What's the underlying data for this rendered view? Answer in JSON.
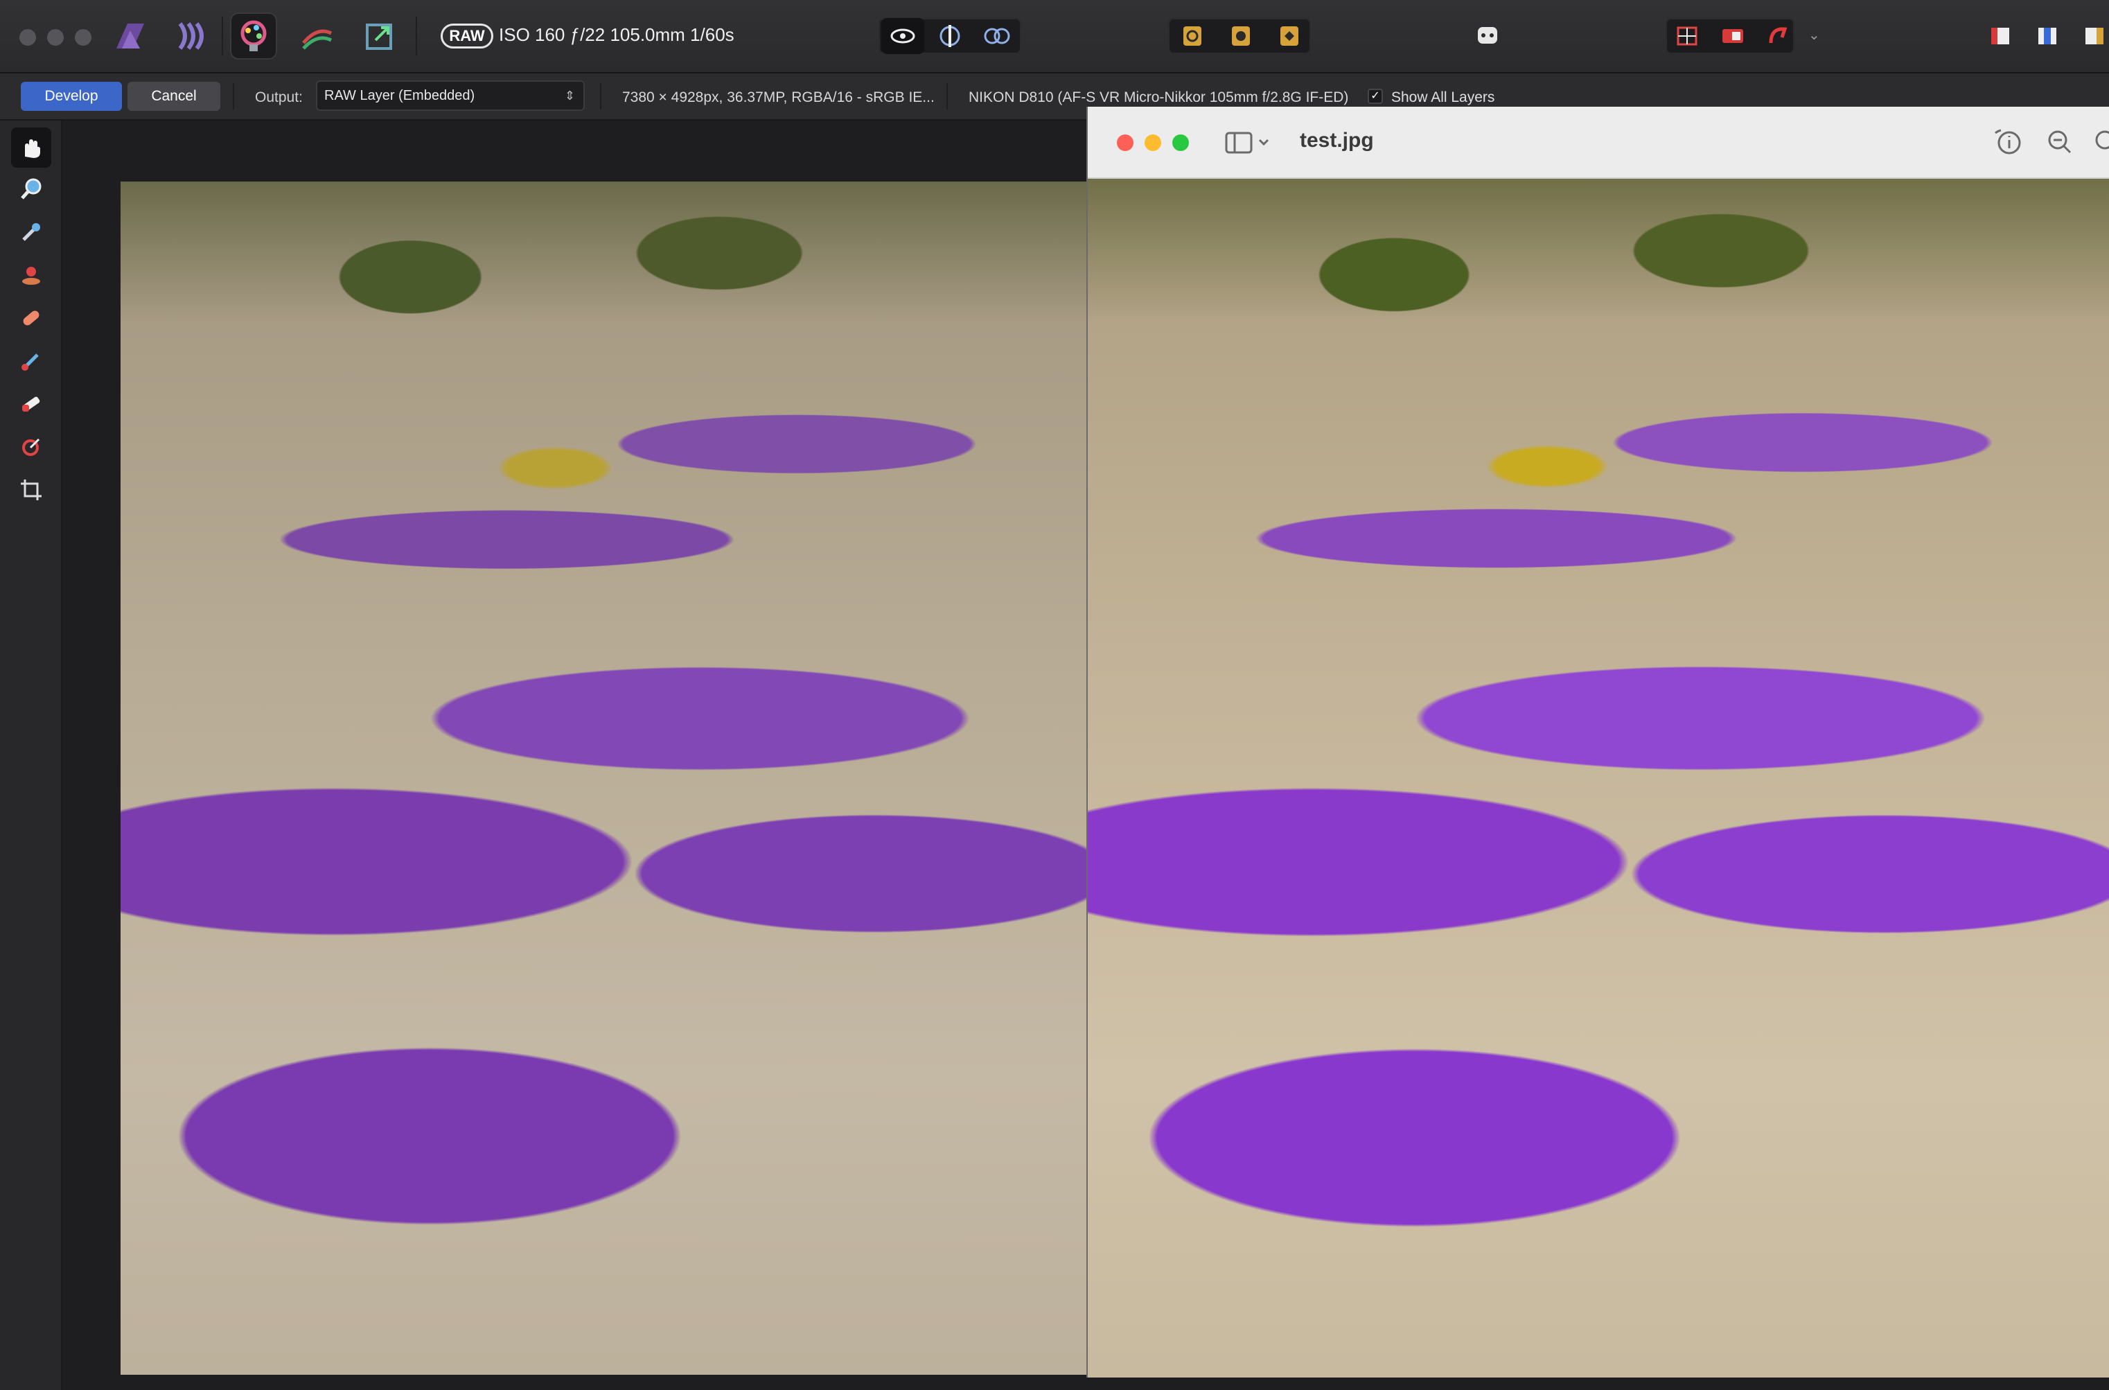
{
  "toolbar": {
    "raw_badge": "RAW",
    "exif": "ISO 160 ƒ/22 105.0mm 1/60s"
  },
  "context_bar": {
    "develop_label": "Develop",
    "cancel_label": "Cancel",
    "output_label": "Output:",
    "output_value": "RAW Layer (Embedded)",
    "doc_info": "7380 × 4928px, 36.37MP, RGBA/16 - sRGB IE...",
    "camera_info": "NIKON D810 (AF-S VR Micro-Nikkor 105mm f/2.8G IF-ED)",
    "show_all_layers_label": "Show All Layers",
    "show_all_layers_checked": true,
    "check_glyph": "✓"
  },
  "tools": [
    "hand-icon",
    "zoom-icon",
    "white-balance-picker-icon",
    "red-eye-icon",
    "blemish-removal-icon",
    "overlay-paint-icon",
    "overlay-erase-icon",
    "overlay-gradient-icon",
    "crop-icon"
  ],
  "preview": {
    "title": "test.jpg"
  },
  "colors": {
    "accent": "#3d66c9",
    "mac_close": "#fe5f57",
    "mac_min": "#febc2e",
    "mac_max": "#28c840"
  }
}
